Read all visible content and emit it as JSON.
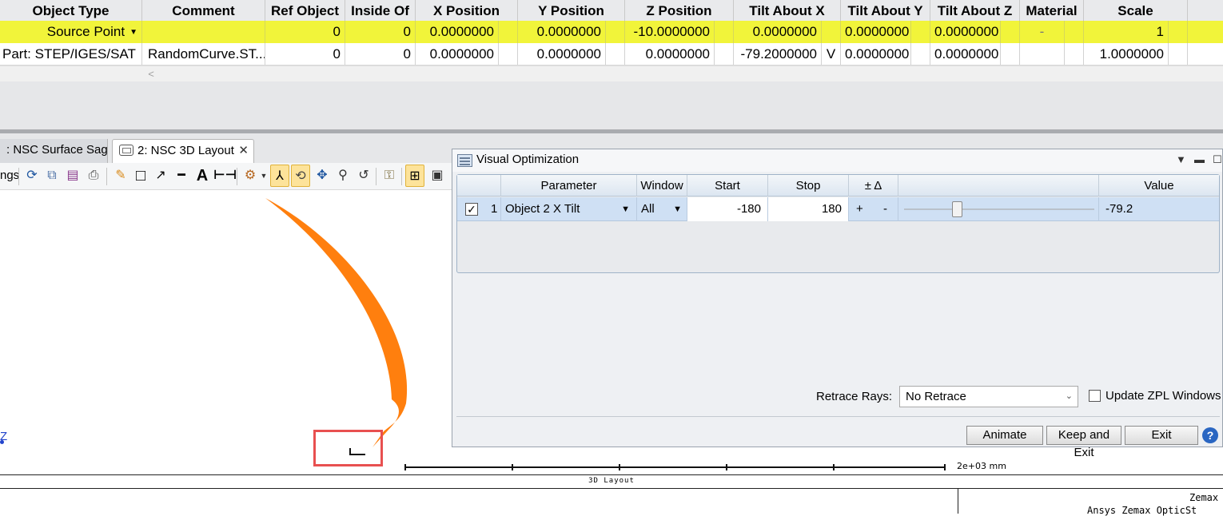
{
  "grid": {
    "headers": [
      "Object Type",
      "Comment",
      "Ref Object",
      "Inside Of",
      "X Position",
      "Y Position",
      "Z Position",
      "Tilt About X",
      "Tilt About Y",
      "Tilt About Z",
      "Material",
      "Scale"
    ],
    "rows": [
      {
        "object_type": "Source Point",
        "comment": "",
        "ref_object": "0",
        "inside_of": "0",
        "x": "0.0000000",
        "y": "0.0000000",
        "z": "-10.0000000",
        "tilt_x": "0.0000000",
        "tilt_x_flag": "",
        "tilt_y": "0.0000000",
        "tilt_z": "0.0000000",
        "material": "-",
        "scale": "1"
      },
      {
        "object_type": "Part: STEP/IGES/SAT",
        "comment": "RandomCurve.ST...",
        "ref_object": "0",
        "inside_of": "0",
        "x": "0.0000000",
        "y": "0.0000000",
        "z": "0.0000000",
        "tilt_x": "-79.2000000",
        "tilt_x_flag": "V",
        "tilt_y": "0.0000000",
        "tilt_z": "0.0000000",
        "material": "",
        "scale": "1.0000000"
      }
    ],
    "highlight_color": "#f1f43a"
  },
  "tabs": [
    {
      "label": ": NSC Surface Sag",
      "active": false
    },
    {
      "label": "2: NSC 3D Layout",
      "active": true
    }
  ],
  "toolbar": {
    "settings_label": "ngs",
    "icons": [
      "refresh-icon",
      "copy-icon",
      "save-icon",
      "print-icon",
      "pencil-icon",
      "rectangle-icon",
      "arrow-line-icon",
      "line-icon",
      "text-icon",
      "dimension-icon",
      "rotate-view-icon",
      "axes-icon",
      "rotate-icon",
      "pan-icon",
      "zoom-icon",
      "undo-zoom-icon",
      "lock-icon",
      "fit-icon",
      "window-icon"
    ]
  },
  "layout": {
    "axis_label": "Z",
    "scale_label": "2e+03 mm",
    "frame_title": "3D Layout",
    "frame_company": "Zemax",
    "frame_product": "Ansys Zemax OpticSt",
    "annotation_color": "#ff7f0e"
  },
  "visual_optimization": {
    "title": "Visual Optimization",
    "headers": [
      "Parameter",
      "Window",
      "Start",
      "Stop",
      "± Δ",
      "Value"
    ],
    "row": {
      "checked": true,
      "index": "1",
      "parameter": "Object 2 X Tilt",
      "window": "All",
      "start": "-180",
      "stop": "180",
      "plus": "+",
      "minus": "-",
      "value": "-79.2",
      "slider_fraction": 0.28
    },
    "retrace_label": "Retrace Rays:",
    "retrace_value": "No Retrace",
    "update_zpl_label": "Update ZPL Windows",
    "update_zpl_checked": false,
    "buttons": {
      "animate": "Animate",
      "keep_exit": "Keep and Exit",
      "exit": "Exit"
    },
    "help": "?"
  }
}
